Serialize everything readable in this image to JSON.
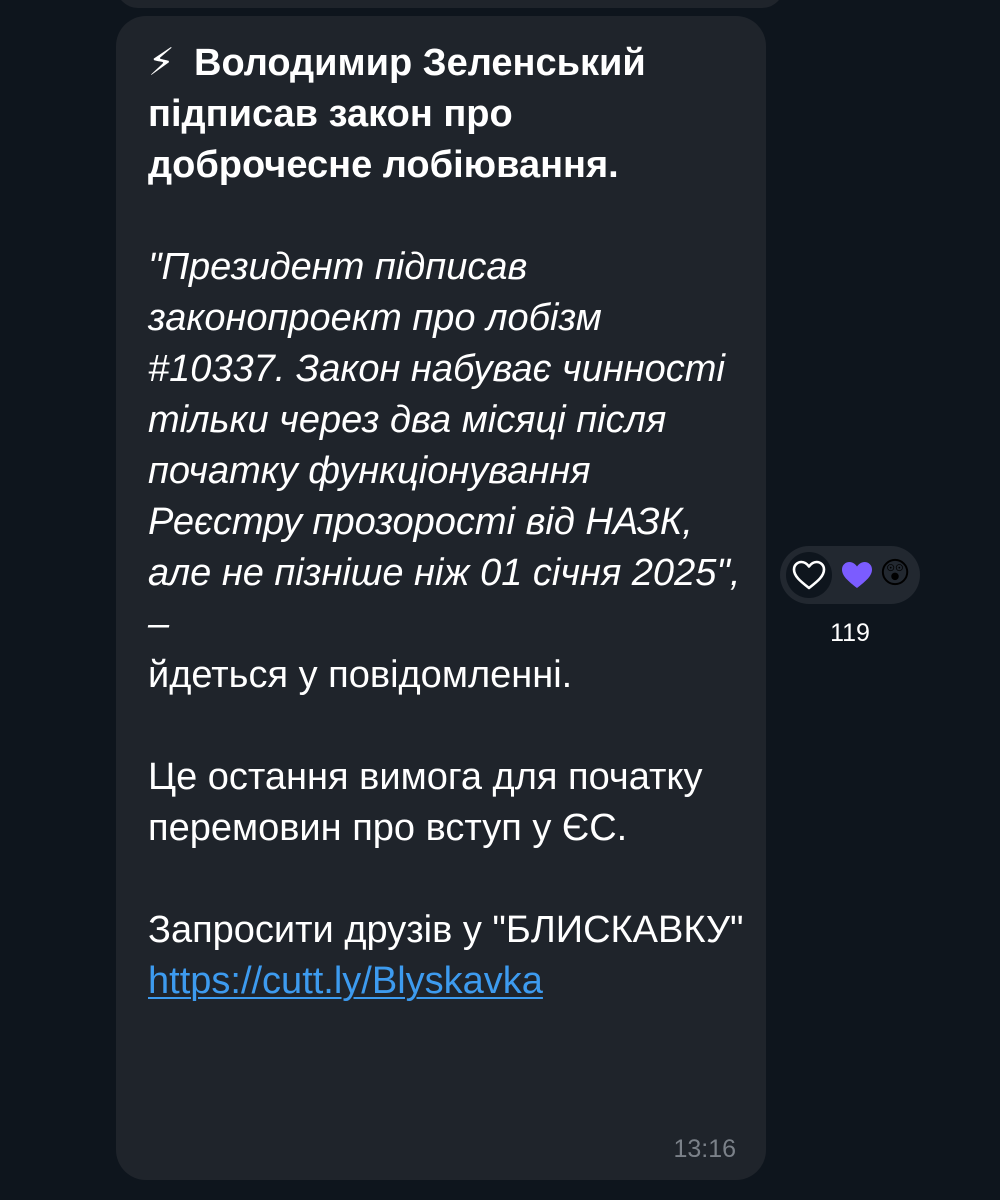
{
  "message": {
    "bolt_emoji": "⚡",
    "headline": "Володимир Зеленський підписав закон про доброчесне лобіювання.",
    "quote": "\"Президент підписав законопроект про лобізм #10337. Закон набуває чинності тільки через два місяці після початку функціонування Реєстру прозорості від НАЗК, але не пізніше ніж 01 січня 2025\", –",
    "quote_tail": "йдеться у повідомленні.",
    "paragraph": "Це остання вимога для початку перемовин про вступ у ЄС.",
    "invite_text": "Запросити друзів у \"БЛИСКАВКУ\"",
    "link": "https://cutt.ly/Blyskavka",
    "time": "13:16"
  },
  "reactions": {
    "icons": [
      "heart-outline-icon",
      "purple-heart-icon",
      "astonished-face-icon"
    ],
    "astonished_emoji": "😲",
    "count": "119"
  },
  "colors": {
    "background": "#0e151d",
    "bubble": "#1f242b",
    "link": "#3d9bef",
    "timestamp": "#7b8189",
    "purple_heart": "#7b5cff"
  }
}
